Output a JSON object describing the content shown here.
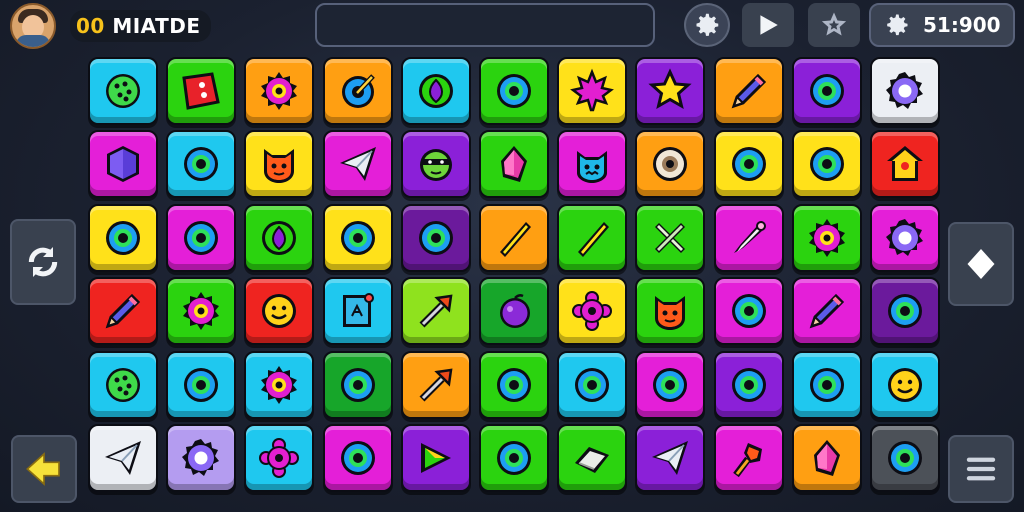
{
  "player": {
    "level_prefix": "00",
    "name": "MIATDE"
  },
  "score": {
    "value": "51:900"
  },
  "colors": {
    "cyan": "#1fc8ef",
    "green": "#2bd30f",
    "orange": "#ff9f12",
    "yellow": "#ffe11a",
    "purple": "#8b20d8",
    "magenta": "#e41fd8",
    "red": "#ef2420",
    "lime": "#8fe21e",
    "white": "#eceff4",
    "lavender": "#b49cf0",
    "dkgreen": "#17a62a",
    "dkpurple": "#6b1a9c",
    "gray": "#4c5158"
  },
  "board": {
    "rows": [
      [
        {
          "color": "cyan",
          "icon": "dotted-ball-icon"
        },
        {
          "color": "green",
          "icon": "dice-icon"
        },
        {
          "color": "orange",
          "icon": "spiky-ring-icon"
        },
        {
          "color": "orange",
          "icon": "target-arrow-icon"
        },
        {
          "color": "cyan",
          "icon": "leaf-ring-icon"
        },
        {
          "color": "green",
          "icon": "ring-icon"
        },
        {
          "color": "yellow",
          "icon": "maple-leaf-icon"
        },
        {
          "color": "purple",
          "icon": "star-icon"
        },
        {
          "color": "orange",
          "icon": "pencil-icon"
        },
        {
          "color": "purple",
          "icon": "ring-icon"
        },
        {
          "color": "white",
          "icon": "gear-ring-icon"
        }
      ],
      [
        {
          "color": "magenta",
          "icon": "cube-icon"
        },
        {
          "color": "cyan",
          "icon": "ring-icon"
        },
        {
          "color": "yellow",
          "icon": "cat-face-icon"
        },
        {
          "color": "magenta",
          "icon": "paper-plane-icon"
        },
        {
          "color": "purple",
          "icon": "ninja-face-icon"
        },
        {
          "color": "green",
          "icon": "crystal-icon"
        },
        {
          "color": "magenta",
          "icon": "monster-face-icon"
        },
        {
          "color": "orange",
          "icon": "donut-icon"
        },
        {
          "color": "yellow",
          "icon": "ring-icon"
        },
        {
          "color": "yellow",
          "icon": "ring-icon"
        },
        {
          "color": "red",
          "icon": "house-icon"
        }
      ],
      [
        {
          "color": "yellow",
          "icon": "ring-icon"
        },
        {
          "color": "magenta",
          "icon": "ring-icon"
        },
        {
          "color": "green",
          "icon": "leaf-ring-icon"
        },
        {
          "color": "yellow",
          "icon": "ring-icon"
        },
        {
          "color": "dkpurple",
          "icon": "ring-icon"
        },
        {
          "color": "orange",
          "icon": "stick-icon"
        },
        {
          "color": "green",
          "icon": "stick-icon"
        },
        {
          "color": "green",
          "icon": "crossed-tools-icon"
        },
        {
          "color": "magenta",
          "icon": "brush-icon"
        },
        {
          "color": "green",
          "icon": "spiky-ring-icon"
        },
        {
          "color": "magenta",
          "icon": "gear-ring-icon"
        }
      ],
      [
        {
          "color": "red",
          "icon": "pencil-icon"
        },
        {
          "color": "green",
          "icon": "spiky-ring-icon"
        },
        {
          "color": "red",
          "icon": "smiley-icon"
        },
        {
          "color": "cyan",
          "icon": "note-icon"
        },
        {
          "color": "lime",
          "icon": "arrow-icon"
        },
        {
          "color": "dkgreen",
          "icon": "ball-icon"
        },
        {
          "color": "yellow",
          "icon": "flower-ring-icon"
        },
        {
          "color": "green",
          "icon": "cat-face-icon"
        },
        {
          "color": "magenta",
          "icon": "ring-icon"
        },
        {
          "color": "magenta",
          "icon": "pencil-icon"
        },
        {
          "color": "dkpurple",
          "icon": "ring-icon"
        }
      ],
      [
        {
          "color": "cyan",
          "icon": "dotted-ball-icon"
        },
        {
          "color": "cyan",
          "icon": "ring-icon"
        },
        {
          "color": "cyan",
          "icon": "spiky-ring-icon"
        },
        {
          "color": "dkgreen",
          "icon": "ring-icon"
        },
        {
          "color": "orange",
          "icon": "arrow-icon"
        },
        {
          "color": "green",
          "icon": "ring-icon"
        },
        {
          "color": "cyan",
          "icon": "ring-icon"
        },
        {
          "color": "magenta",
          "icon": "ring-icon"
        },
        {
          "color": "purple",
          "icon": "ring-icon"
        },
        {
          "color": "cyan",
          "icon": "ring-icon"
        },
        {
          "color": "cyan",
          "icon": "smiley-icon"
        }
      ],
      [
        {
          "color": "white",
          "icon": "paper-plane-icon"
        },
        {
          "color": "lavender",
          "icon": "gear-ring-icon"
        },
        {
          "color": "cyan",
          "icon": "flower-ring-icon"
        },
        {
          "color": "magenta",
          "icon": "ring-icon"
        },
        {
          "color": "purple",
          "icon": "pennant-icon"
        },
        {
          "color": "green",
          "icon": "ring-icon"
        },
        {
          "color": "green",
          "icon": "eraser-icon"
        },
        {
          "color": "purple",
          "icon": "paper-plane-icon"
        },
        {
          "color": "magenta",
          "icon": "torch-icon"
        },
        {
          "color": "orange",
          "icon": "crystal-icon"
        },
        {
          "color": "gray",
          "icon": "ring-icon"
        }
      ]
    ]
  }
}
